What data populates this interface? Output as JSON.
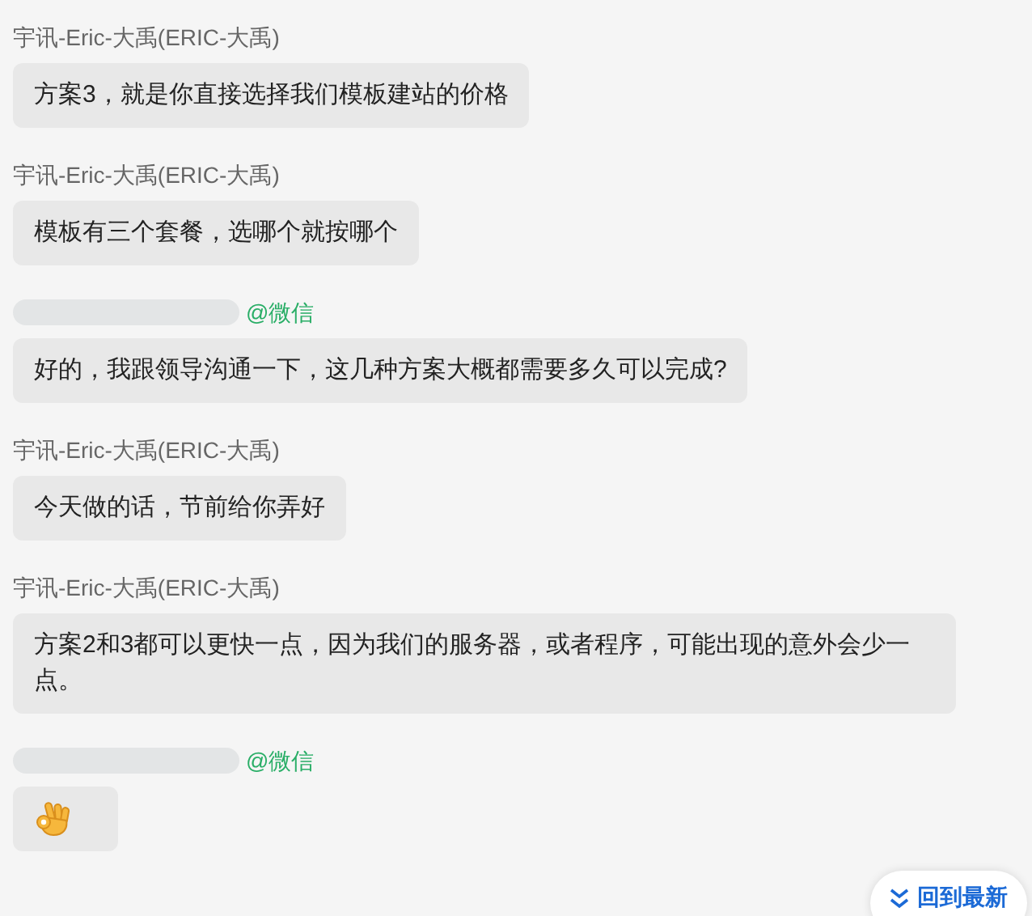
{
  "messages": [
    {
      "sender": {
        "kind": "internal",
        "name": "宇讯-Eric-大禹(ERIC-大禹)"
      },
      "kind": "text",
      "text": "方案3，就是你直接选择我们模板建站的价格"
    },
    {
      "sender": {
        "kind": "internal",
        "name": "宇讯-Eric-大禹(ERIC-大禹)"
      },
      "kind": "text",
      "text": "模板有三个套餐，选哪个就按哪个"
    },
    {
      "sender": {
        "kind": "external",
        "name": "@微信"
      },
      "kind": "text",
      "text": "好的，我跟领导沟通一下，这几种方案大概都需要多久可以完成?"
    },
    {
      "sender": {
        "kind": "internal",
        "name": "宇讯-Eric-大禹(ERIC-大禹)"
      },
      "kind": "text",
      "text": "今天做的话，节前给你弄好"
    },
    {
      "sender": {
        "kind": "internal",
        "name": "宇讯-Eric-大禹(ERIC-大禹)"
      },
      "kind": "text",
      "text": "方案2和3都可以更快一点，因为我们的服务器，或者程序，可能出现的意外会少一点。"
    },
    {
      "sender": {
        "kind": "external",
        "name": "@微信"
      },
      "kind": "sticker"
    }
  ],
  "jump_button": {
    "label": "回到最新"
  }
}
